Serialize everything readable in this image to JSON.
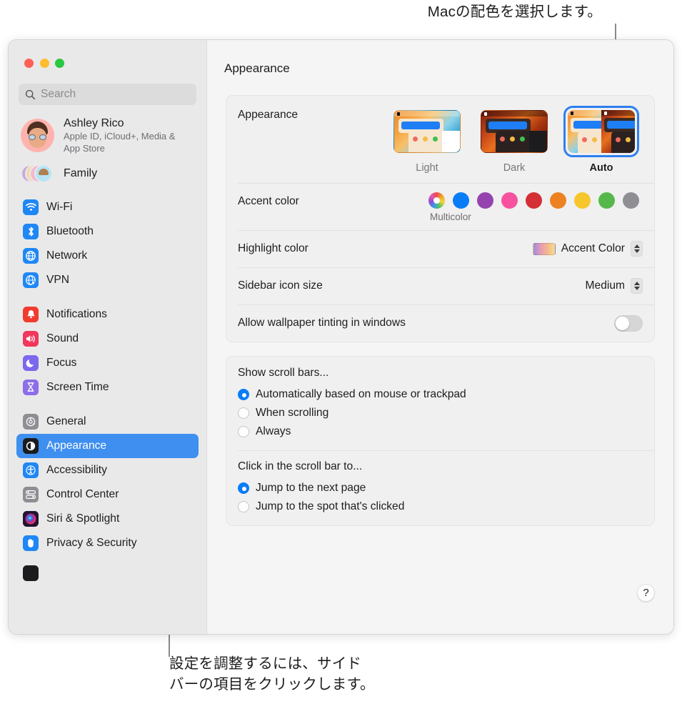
{
  "annotations": {
    "top": "Macの配色を選択します。",
    "bottom": "設定を調整するには、サイド\nバーの項目をクリックします。"
  },
  "window": {
    "title": "Appearance",
    "traffic_lights": [
      "close",
      "minimize",
      "maximize"
    ]
  },
  "sidebar": {
    "search": {
      "placeholder": "Search",
      "value": ""
    },
    "account": {
      "name": "Ashley Rico",
      "subtitle": "Apple ID, iCloud+, Media & App Store"
    },
    "family": {
      "label": "Family"
    },
    "groups": [
      {
        "items": [
          {
            "label": "Wi-Fi",
            "icon": "wifi-icon",
            "color": "#1f87f5"
          },
          {
            "label": "Bluetooth",
            "icon": "bluetooth-icon",
            "color": "#1f87f5"
          },
          {
            "label": "Network",
            "icon": "globe-icon",
            "color": "#1f87f5"
          },
          {
            "label": "VPN",
            "icon": "vpn-globe-icon",
            "color": "#1f87f5"
          }
        ]
      },
      {
        "items": [
          {
            "label": "Notifications",
            "icon": "bell-icon",
            "color": "#f23b2f"
          },
          {
            "label": "Sound",
            "icon": "speaker-icon",
            "color": "#f2365c"
          },
          {
            "label": "Focus",
            "icon": "moon-icon",
            "color": "#7b68ee"
          },
          {
            "label": "Screen Time",
            "icon": "hourglass-icon",
            "color": "#8b6ee8"
          }
        ]
      },
      {
        "items": [
          {
            "label": "General",
            "icon": "gear-icon",
            "color": "#8e8e93"
          },
          {
            "label": "Appearance",
            "icon": "appearance-icon",
            "color": "#1c1c1e",
            "selected": true
          },
          {
            "label": "Accessibility",
            "icon": "accessibility-icon",
            "color": "#1f87f5"
          },
          {
            "label": "Control Center",
            "icon": "control-center-icon",
            "color": "#8e8e93"
          },
          {
            "label": "Siri & Spotlight",
            "icon": "siri-icon",
            "color": "#2a1a3a"
          },
          {
            "label": "Privacy & Security",
            "icon": "hand-icon",
            "color": "#1f87f5"
          }
        ]
      }
    ]
  },
  "main": {
    "appearance_row": {
      "label": "Appearance",
      "options": [
        {
          "label": "Light",
          "selected": false
        },
        {
          "label": "Dark",
          "selected": false
        },
        {
          "label": "Auto",
          "selected": true
        }
      ]
    },
    "accent_row": {
      "label": "Accent color",
      "caption": "Multicolor",
      "swatches": [
        {
          "name": "multicolor",
          "color": "multicolor",
          "selected": true
        },
        {
          "name": "blue",
          "color": "#0a7cf7"
        },
        {
          "name": "purple",
          "color": "#9543ae"
        },
        {
          "name": "pink",
          "color": "#f7529f"
        },
        {
          "name": "red",
          "color": "#d32f35"
        },
        {
          "name": "orange",
          "color": "#ed8222"
        },
        {
          "name": "yellow",
          "color": "#f6c62c"
        },
        {
          "name": "green",
          "color": "#56b84a"
        },
        {
          "name": "graphite",
          "color": "#8e8e93"
        }
      ]
    },
    "highlight_row": {
      "label": "Highlight color",
      "value": "Accent Color"
    },
    "sidebar_icon_row": {
      "label": "Sidebar icon size",
      "value": "Medium"
    },
    "tinting_row": {
      "label": "Allow wallpaper tinting in windows",
      "enabled": false
    },
    "scrollbar_group": {
      "title": "Show scroll bars...",
      "options": [
        {
          "label": "Automatically based on mouse or trackpad",
          "selected": true
        },
        {
          "label": "When scrolling",
          "selected": false
        },
        {
          "label": "Always",
          "selected": false
        }
      ]
    },
    "scroll_click_group": {
      "title": "Click in the scroll bar to...",
      "options": [
        {
          "label": "Jump to the next page",
          "selected": true
        },
        {
          "label": "Jump to the spot that's clicked",
          "selected": false
        }
      ]
    },
    "help_button": "?"
  }
}
